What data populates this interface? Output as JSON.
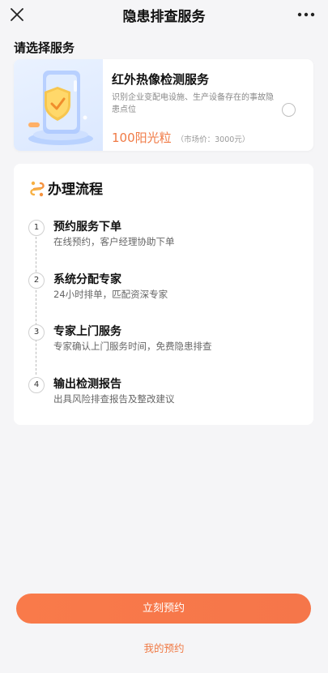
{
  "nav": {
    "title": "隐患排查服务",
    "close_icon": "close-icon",
    "more_icon": "more-icon"
  },
  "section": {
    "select_title": "请选择服务"
  },
  "service": {
    "name": "红外热像检测服务",
    "description": "识别企业变配电设施、生产设备存在的事故隐患点位",
    "price": "100阳光粒",
    "market_price": "（市场价：3000元）",
    "image_icon": "shield-phone-illustration",
    "selected": false
  },
  "process": {
    "title": "办理流程",
    "icon": "process-link-icon",
    "steps": [
      {
        "num": "1",
        "title": "预约服务下单",
        "desc": "在线预约，客户经理协助下单"
      },
      {
        "num": "2",
        "title": "系统分配专家",
        "desc": "24小时排单，匹配资深专家"
      },
      {
        "num": "3",
        "title": "专家上门服务",
        "desc": "专家确认上门服务时间，免费隐患排查"
      },
      {
        "num": "4",
        "title": "输出检测报告",
        "desc": "出具风险排查报告及整改建议"
      }
    ]
  },
  "actions": {
    "book_label": "立刻预约",
    "my_booking_label": "我的预约"
  },
  "colors": {
    "accent": "#f5764a",
    "price": "#f07a45",
    "background": "#f5f5f7"
  }
}
